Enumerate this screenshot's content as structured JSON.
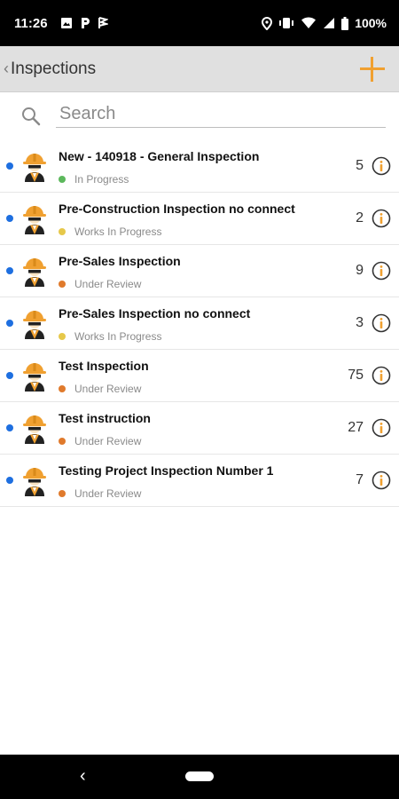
{
  "status_bar": {
    "time": "11:26",
    "battery": "100%",
    "left_icons": [
      "image-icon",
      "parking-icon",
      "flag-icon"
    ],
    "right_icons": [
      "location-icon",
      "vibrate-icon",
      "wifi-icon",
      "signal-icon",
      "battery-icon"
    ]
  },
  "app_bar": {
    "back_chevron": "‹",
    "title": "Inspections",
    "add_icon": "plus-icon",
    "accent_color": "#f0a030"
  },
  "search": {
    "placeholder": "Search",
    "value": ""
  },
  "colors": {
    "unread_dot": "#1e6fe0",
    "status_green": "#5cb85c",
    "status_yellow": "#e6c84a",
    "status_orange": "#e07a2c"
  },
  "inspections": [
    {
      "title": "New - 140918 - General Inspection",
      "status": "In Progress",
      "status_color": "#5cb85c",
      "count": "5"
    },
    {
      "title": "Pre-Construction Inspection no connect",
      "status": "Works In Progress",
      "status_color": "#e6c84a",
      "count": "2"
    },
    {
      "title": "Pre-Sales Inspection",
      "status": "Under Review",
      "status_color": "#e07a2c",
      "count": "9"
    },
    {
      "title": "Pre-Sales Inspection no connect",
      "status": "Works In Progress",
      "status_color": "#e6c84a",
      "count": "3"
    },
    {
      "title": "Test Inspection",
      "status": "Under Review",
      "status_color": "#e07a2c",
      "count": "75"
    },
    {
      "title": "Test instruction",
      "status": "Under Review",
      "status_color": "#e07a2c",
      "count": "27"
    },
    {
      "title": "Testing Project Inspection Number 1",
      "status": "Under Review",
      "status_color": "#e07a2c",
      "count": "7"
    }
  ],
  "nav_bar": {
    "back_glyph": "‹"
  }
}
